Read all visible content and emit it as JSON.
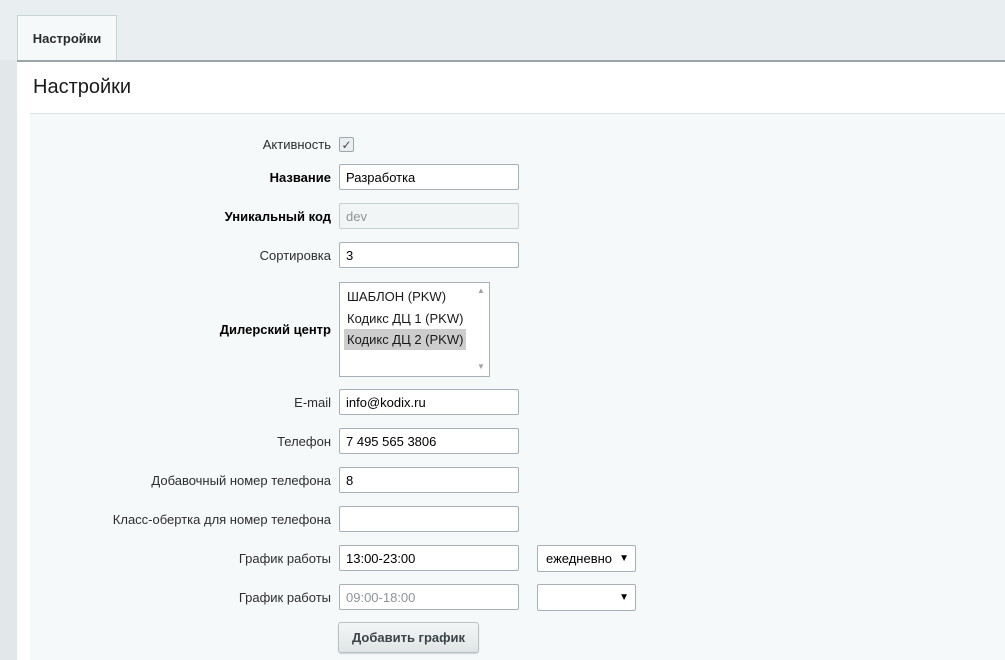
{
  "tabs": [
    {
      "label": "Настройки"
    }
  ],
  "panel": {
    "title": "Настройки"
  },
  "form": {
    "active": {
      "label": "Активность",
      "checked": true
    },
    "name": {
      "label": "Название",
      "value": "Разработка"
    },
    "code": {
      "label": "Уникальный код",
      "placeholder": "dev"
    },
    "sort": {
      "label": "Сортировка",
      "value": "3"
    },
    "dealer": {
      "label": "Дилерский центр",
      "options": [
        "ШАБЛОН (PKW)",
        "Кодикс ДЦ 1 (PKW)",
        "Кодикс ДЦ 2 (PKW)"
      ],
      "selected": "Кодикс ДЦ 2 (PKW)"
    },
    "email": {
      "label": "E-mail",
      "value": "info@kodix.ru"
    },
    "phone": {
      "label": "Телефон",
      "value": "7 495 565 3806"
    },
    "phone_ext": {
      "label": "Добавочный номер телефона",
      "value": "8"
    },
    "phone_class": {
      "label": "Класс-обертка для номер телефона",
      "value": ""
    },
    "schedule_1": {
      "label": "График работы",
      "value": "13:00-23:00",
      "period": "ежедневно"
    },
    "schedule_2": {
      "label": "График работы",
      "placeholder": "09:00-18:00",
      "period": ""
    },
    "add_button": {
      "label": "Добавить график"
    }
  },
  "icons": {
    "check": "check-icon",
    "dropdown": "caret-down-icon",
    "scroll_up": "scroll-up-icon",
    "scroll_down": "scroll-down-icon"
  }
}
